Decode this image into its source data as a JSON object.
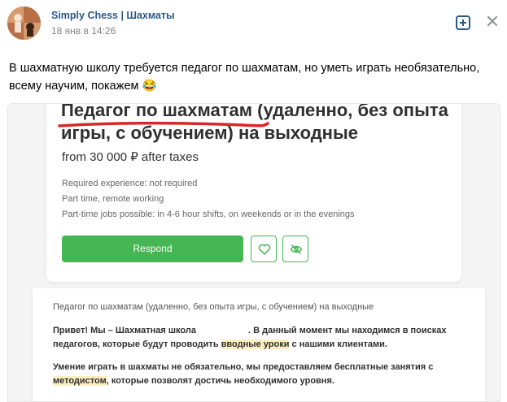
{
  "post": {
    "author_name": "Simply Chess | Шахматы",
    "date": "18 янв в 14:26",
    "text": "В шахматную школу требуется педагог по шахматам, но уметь играть необязательно, всему научим, покажем 😂"
  },
  "vacancy": {
    "title_part1": "Педагог по шахматам",
    "title_part2": " (удаленно, без опыта игры, с обучением) на выходные",
    "salary": "from 30 000 ₽ after taxes",
    "conditions": [
      "Required experience: not required",
      "Part time, remote working",
      "Part-time jobs possible: in 4-6 hour shifts, on weekends or in the evenings"
    ],
    "respond_label": "Respond",
    "description_title": "Педагог по шахматам (удаленно, без опыта игры, с обучением) на выходные",
    "p1_a": "Привет! Мы – Шахматная школа",
    "p1_b": ". В данный момент мы находимся в поисках педагогов, которые будут проводить ",
    "p1_hl": "вводные уроки",
    "p1_c": " с нашими клиентами.",
    "p2_a": "Умение играть в шахматы не обязательно, мы предоставляем бесплатные занятия с ",
    "p2_hl": "методистом",
    "p2_b": ", которые позволят достичь необходимого уровня."
  },
  "colors": {
    "link": "#2a5885",
    "green": "#46b655",
    "underline": "#d62828",
    "highlight": "#fbeec0"
  },
  "icons": [
    "plus-square-icon",
    "close-icon",
    "heart-icon",
    "eye-off-icon"
  ]
}
